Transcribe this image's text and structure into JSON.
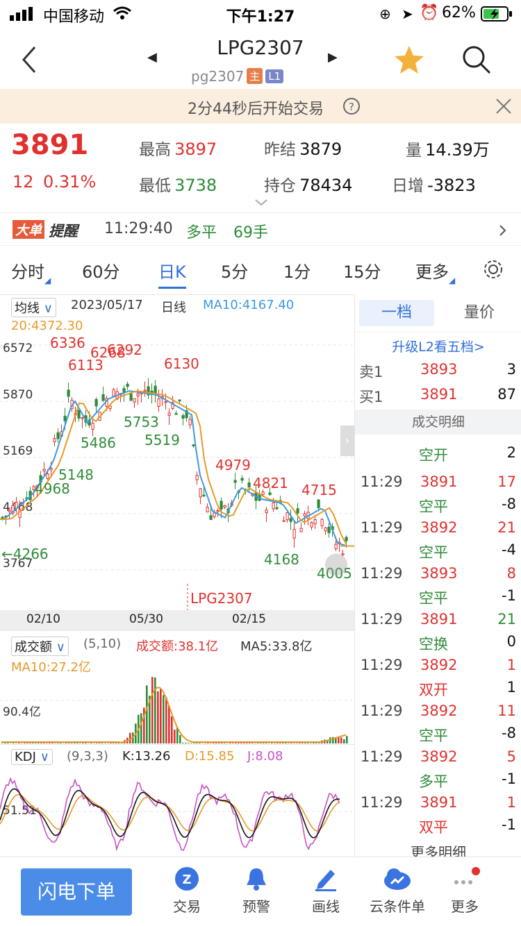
{
  "status": {
    "carrier": "中国移动",
    "time": "下午1:27",
    "battery": "62%"
  },
  "nav": {
    "title": "LPG2307",
    "code": "pg2307",
    "tag_main": "主",
    "tag_level": "L1"
  },
  "notice": {
    "text": "2分44秒后开始交易"
  },
  "quote": {
    "price": "3891",
    "change": "12",
    "change_pct": "0.31%",
    "high_label": "最高",
    "high": "3897",
    "low_label": "最低",
    "low": "3738",
    "prev_label": "昨结",
    "prev": "3879",
    "oi_label": "持仓",
    "oi": "78434",
    "vol_label": "量",
    "vol": "14.39万",
    "daily_label": "日增",
    "daily": "-3823"
  },
  "alert": {
    "tag1": "大单",
    "tag2": "提醒",
    "time": "11:29:40",
    "type": "多平",
    "qty": "69手"
  },
  "tabs": [
    "分时",
    "60分",
    "日K",
    "5分",
    "1分",
    "15分",
    "更多"
  ],
  "kline": {
    "ma_type": "均线",
    "date": "2023/05/17",
    "period": "日线",
    "ma10": "MA10:4167.40",
    "ma20": "20:4372.30",
    "y_labels": [
      "6572",
      "5870",
      "5169",
      "4468",
      "3767"
    ],
    "peak_labels": [
      "6336",
      "6113",
      "6268",
      "6292",
      "6130",
      "5753",
      "5519",
      "5486",
      "5148",
      "4968",
      "4266",
      "4979",
      "4821",
      "4715",
      "4168",
      "4005"
    ],
    "x_labels": [
      "02/10",
      "05/30",
      "02/15"
    ],
    "contract_label": "LPG2307"
  },
  "volume": {
    "indicator": "成交额",
    "params": "(5,10)",
    "amount": "成交额:38.1亿",
    "ma5": "MA5:33.8亿",
    "ma10": "MA10:27.2亿",
    "y_label": "90.4亿"
  },
  "kdj": {
    "indicator": "KDJ",
    "params": "(9,3,3)",
    "k": "K:13.26",
    "d": "D:15.85",
    "j": "J:8.08",
    "y_label": "51.51"
  },
  "side": {
    "tab1": "一档",
    "tab2": "量价",
    "upgrade": "升级L2看五档>",
    "ask_label": "卖1",
    "ask_price": "3893",
    "ask_qty": "3",
    "bid_label": "买1",
    "bid_price": "3891",
    "bid_qty": "87",
    "detail_title": "成交明细",
    "partial": {
      "type": "空开",
      "change": "2"
    },
    "trades": [
      {
        "time": "11:29",
        "price": "3891",
        "vol": "17",
        "type": "空平",
        "change": "-8"
      },
      {
        "time": "11:29",
        "price": "3892",
        "vol": "21",
        "type": "空平",
        "change": "-4"
      },
      {
        "time": "11:29",
        "price": "3893",
        "vol": "8",
        "type": "空平",
        "change": "-1"
      },
      {
        "time": "11:29",
        "price": "3891",
        "vol": "21",
        "type": "空换",
        "change": "0"
      },
      {
        "time": "11:29",
        "price": "3892",
        "vol": "1",
        "type": "双开",
        "change": "1"
      },
      {
        "time": "11:29",
        "price": "3892",
        "vol": "11",
        "type": "空平",
        "change": "-8"
      },
      {
        "time": "11:29",
        "price": "3892",
        "vol": "5",
        "type": "多平",
        "change": "-1"
      },
      {
        "time": "11:29",
        "price": "3891",
        "vol": "1",
        "type": "双平",
        "change": "-1"
      }
    ],
    "more": "更多明细"
  },
  "bottom": {
    "flash": "闪电下单",
    "items": [
      "交易",
      "预警",
      "画线",
      "云条件单",
      "更多"
    ]
  },
  "colors": {
    "up": "#e0312e",
    "down": "#2e8b3a",
    "accent": "#2f6fd8",
    "ma_blue": "#3b9ae0",
    "ma_orange": "#e59a2a",
    "magenta": "#c84fc8"
  }
}
